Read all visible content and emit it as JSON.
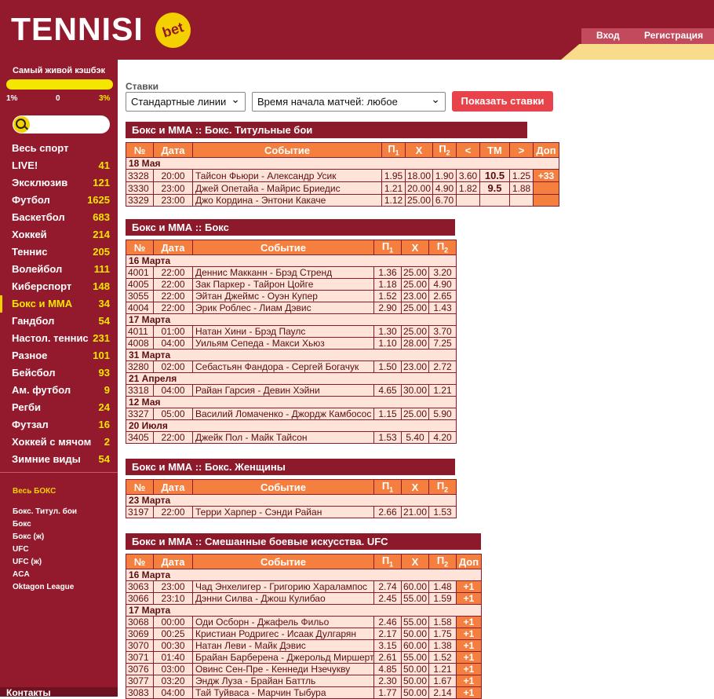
{
  "header": {
    "logo": "TENNISI",
    "logo_badge": "bet",
    "login": "Вход",
    "register": "Регистрация"
  },
  "cashback": {
    "title": "Самый живой кэшбэк",
    "left": "1%",
    "mid": "0",
    "right": "3%"
  },
  "sports": [
    {
      "name": "Весь спорт",
      "count": ""
    },
    {
      "name": "LIVE!",
      "count": "41"
    },
    {
      "name": "Эксклюзив",
      "count": "121"
    },
    {
      "name": "Футбол",
      "count": "1625"
    },
    {
      "name": "Баскетбол",
      "count": "683"
    },
    {
      "name": "Хоккей",
      "count": "214"
    },
    {
      "name": "Теннис",
      "count": "205"
    },
    {
      "name": "Волейбол",
      "count": "111"
    },
    {
      "name": "Киберспорт",
      "count": "148"
    },
    {
      "name": "Бокс и ММА",
      "count": "34"
    },
    {
      "name": "Гандбол",
      "count": "54"
    },
    {
      "name": "Настол. теннис",
      "count": "231"
    },
    {
      "name": "Разное",
      "count": "101"
    },
    {
      "name": "Бейсбол",
      "count": "93"
    },
    {
      "name": "Ам. футбол",
      "count": "9"
    },
    {
      "name": "Регби",
      "count": "24"
    },
    {
      "name": "Футзал",
      "count": "16"
    },
    {
      "name": "Хоккей с мячом",
      "count": "2"
    },
    {
      "name": "Зимние виды",
      "count": "54"
    }
  ],
  "subcats": {
    "all": "Весь БОКС",
    "items": [
      "Бокс. Титул. бои",
      "Бокс",
      "Бокс (ж)",
      "UFC",
      "UFC (ж)",
      "ACA",
      "Oktagon League"
    ]
  },
  "contacts": "Контакты",
  "filters": {
    "label": "Ставки",
    "lines": "Стандартные линии",
    "time": "Время начала матчей: любое",
    "show": "Показать ставки"
  },
  "headers": {
    "num": "№",
    "date": "Дата",
    "event": "Событие",
    "p1": "П",
    "x": "Х",
    "p2": "П",
    "lt": "<",
    "tm": "ТМ",
    "gt": ">",
    "dop": "Доп",
    "sub1": "1",
    "sub2": "2"
  },
  "sections": [
    {
      "title": "Бокс и ММА :: Бокс. Титульные бои",
      "groups": [
        {
          "date": "18 Мая",
          "rows": [
            {
              "num": "3328",
              "time": "20:00",
              "event": "Тайсон Фьюри - Александр Усик",
              "p1": "1.95",
              "x": "18.00",
              "p2": "1.90",
              "lt": "3.60",
              "tm": "10.5",
              "gt": "1.25",
              "dop": "+33"
            },
            {
              "num": "3330",
              "time": "23:00",
              "event": "Джей Опетайа - Майрис Бриедис",
              "p1": "1.21",
              "x": "20.00",
              "p2": "4.90",
              "lt": "1.82",
              "tm": "9.5",
              "gt": "1.88",
              "dop": ""
            },
            {
              "num": "3329",
              "time": "23:00",
              "event": "Джо Кордина - Энтони Какаче",
              "p1": "1.12",
              "x": "25.00",
              "p2": "6.70",
              "lt": "",
              "tm": "",
              "gt": "",
              "dop": ""
            }
          ]
        }
      ]
    },
    {
      "title": "Бокс и ММА :: Бокс",
      "groups": [
        {
          "date": "16 Марта",
          "rows": [
            {
              "num": "4001",
              "time": "22:00",
              "event": "Деннис Макканн - Брэд Стренд",
              "p1": "1.36",
              "x": "25.00",
              "p2": "3.20"
            },
            {
              "num": "4005",
              "time": "22:00",
              "event": "Зак Паркер - Тайрон Цойге",
              "p1": "1.18",
              "x": "25.00",
              "p2": "4.90"
            },
            {
              "num": "3055",
              "time": "22:00",
              "event": "Эйтан Джеймс - Оуэн Купер",
              "p1": "1.52",
              "x": "23.00",
              "p2": "2.65"
            },
            {
              "num": "4004",
              "time": "22:00",
              "event": "Эрик Роблес - Лиам Дэвис",
              "p1": "2.90",
              "x": "25.00",
              "p2": "1.43"
            }
          ]
        },
        {
          "date": "17 Марта",
          "rows": [
            {
              "num": "4011",
              "time": "01:00",
              "event": "Натан Хини - Брэд Паулс",
              "p1": "1.30",
              "x": "25.00",
              "p2": "3.70"
            },
            {
              "num": "4008",
              "time": "04:00",
              "event": "Уильям Сепеда - Макси Хьюз",
              "p1": "1.10",
              "x": "28.00",
              "p2": "7.25"
            }
          ]
        },
        {
          "date": "31 Марта",
          "rows": [
            {
              "num": "3280",
              "time": "02:00",
              "event": "Себастьян Фандора - Сергей Богачук",
              "p1": "1.50",
              "x": "23.00",
              "p2": "2.72"
            }
          ]
        },
        {
          "date": "21 Апреля",
          "rows": [
            {
              "num": "3318",
              "time": "04:00",
              "event": "Райан Гарсия - Девин Хэйни",
              "p1": "4.65",
              "x": "30.00",
              "p2": "1.21"
            }
          ]
        },
        {
          "date": "12 Мая",
          "rows": [
            {
              "num": "3327",
              "time": "05:00",
              "event": "Василий Ломаченко - Джордж Камбосос",
              "p1": "1.15",
              "x": "25.00",
              "p2": "5.90"
            }
          ]
        },
        {
          "date": "20 Июля",
          "rows": [
            {
              "num": "3405",
              "time": "22:00",
              "event": "Джейк Пол - Майк Тайсон",
              "p1": "1.53",
              "x": "5.40",
              "p2": "4.20"
            }
          ]
        }
      ]
    },
    {
      "title": "Бокс и ММА :: Бокс. Женщины",
      "groups": [
        {
          "date": "23 Марта",
          "rows": [
            {
              "num": "3197",
              "time": "22:00",
              "event": "Терри Харпер - Сэнди Райан",
              "p1": "2.66",
              "x": "21.00",
              "p2": "1.53"
            }
          ]
        }
      ]
    },
    {
      "title": "Бокс и ММА :: Смешанные боевые искусства. UFC",
      "groups": [
        {
          "date": "16 Марта",
          "rows": [
            {
              "num": "3063",
              "time": "23:00",
              "event": "Чад Энхелигер - Григорию Харалампос",
              "p1": "2.74",
              "x": "60.00",
              "p2": "1.48",
              "dop": "+1"
            },
            {
              "num": "3066",
              "time": "23:10",
              "event": "Дэнни Силва - Джош Кулибао",
              "p1": "2.45",
              "x": "55.00",
              "p2": "1.59",
              "dop": "+1"
            }
          ]
        },
        {
          "date": "17 Марта",
          "rows": [
            {
              "num": "3068",
              "time": "00:00",
              "event": "Оди Осборн - Джафель Фильо",
              "p1": "2.46",
              "x": "55.00",
              "p2": "1.58",
              "dop": "+1"
            },
            {
              "num": "3069",
              "time": "00:25",
              "event": "Кристиан Родригес - Исаак Дулгарян",
              "p1": "2.17",
              "x": "50.00",
              "p2": "1.75",
              "dop": "+1"
            },
            {
              "num": "3070",
              "time": "00:30",
              "event": "Натан Леви - Майк Дэвис",
              "p1": "3.15",
              "x": "60.00",
              "p2": "1.38",
              "dop": "+1"
            },
            {
              "num": "3071",
              "time": "01:40",
              "event": "Брайан Барберена - Джерольд Миршерт",
              "p1": "2.61",
              "x": "55.00",
              "p2": "1.52",
              "dop": "+1"
            },
            {
              "num": "3076",
              "time": "03:00",
              "event": "Овинс Сен-Пре - Кеннеди Нзечукву",
              "p1": "4.85",
              "x": "50.00",
              "p2": "1.21",
              "dop": "+1"
            },
            {
              "num": "3077",
              "time": "03:20",
              "event": "Эндж Луза - Брайан Баттль",
              "p1": "2.30",
              "x": "50.00",
              "p2": "1.67",
              "dop": "+1"
            },
            {
              "num": "3083",
              "time": "04:00",
              "event": "Тай Туйваса - Марчин Тыбура",
              "p1": "1.77",
              "x": "50.00",
              "p2": "2.14",
              "dop": "+1"
            }
          ]
        }
      ]
    }
  ]
}
